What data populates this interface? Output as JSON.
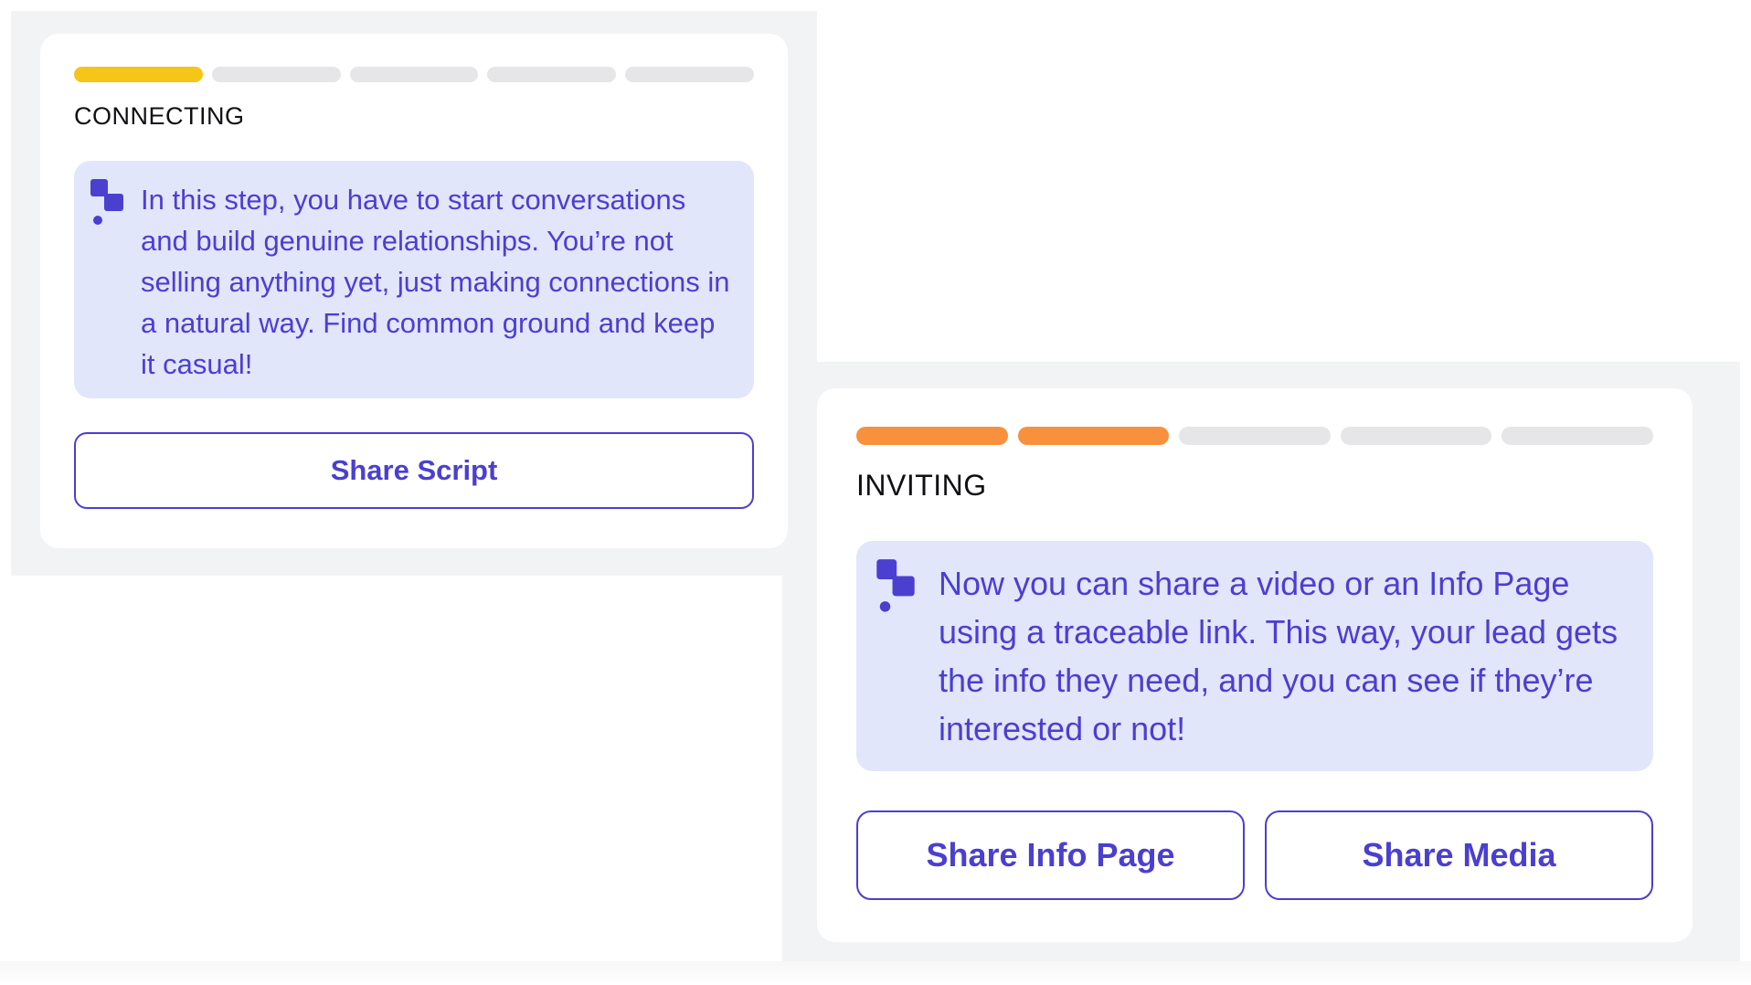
{
  "steps": [
    {
      "title": "CONNECTING",
      "progress": {
        "total": 5,
        "completed": 1,
        "active_color": "#f5c518"
      },
      "tip": "In this step, you have to start conversations and build genuine relationships. You’re not selling anything yet, just making connections in a natural way. Find common ground and keep it casual!",
      "tip_icon": "assistant-logo-icon",
      "buttons": [
        "Share Script"
      ]
    },
    {
      "title": "INVITING",
      "progress": {
        "total": 5,
        "completed": 2,
        "active_color": "#f7913d"
      },
      "tip": "Now you can share a video or an Info Page using a traceable link. This way, your lead gets the info they need, and you can see if they’re interested or not!",
      "tip_icon": "assistant-logo-icon",
      "buttons": [
        "Share Info Page",
        "Share Media"
      ]
    }
  ],
  "colors": {
    "accent": "#4b3fd0",
    "tip_background": "#e1e6fb",
    "inactive_segment": "#e6e6e8",
    "panel_background": "#f2f3f5"
  }
}
